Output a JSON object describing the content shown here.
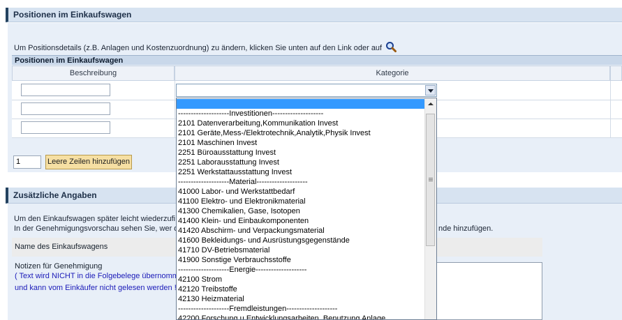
{
  "section1": {
    "title": "Positionen im Einkaufswagen",
    "info": "Um Positionsdetails (z.B. Anlagen und Kostenzuordnung) zu ändern, klicken Sie unten auf den Link oder auf"
  },
  "table": {
    "title": "Positionen im Einkaufswagen",
    "col_description": "Beschreibung",
    "col_category": "Kategorie"
  },
  "add_rows": {
    "quantity": "1",
    "button_label": "Leere Zeilen hinzufügen"
  },
  "section2": {
    "title": "Zusätzliche Angaben",
    "line1": "Um den Einkaufswagen später leicht wiederzufi",
    "line2": "In der Genehmigungsvorschau sehen Sie, wer d",
    "line2_end": "nde hinzufügen.",
    "cart_name_label": "Name des Einkaufswagens",
    "notes_label": "Notizen für Genehmigung",
    "note_blue_1": "( Text wird NICHT in die Folgebelege übernomme",
    "note_blue_2": "und kann vom Einkäufer nicht gelesen werden !"
  },
  "dropdown_options": [
    "",
    "--------------------Investitionen--------------------",
    "2101 Datenverarbeitung,Kommunikation Invest",
    "2101 Geräte,Mess-/Elektrotechnik,Analytik,Physik Invest",
    "2101 Maschinen Invest",
    "2251 Büroausstattung Invest",
    "2251 Laborausstattung Invest",
    "2251 Werkstattausstattung Invest",
    "--------------------Material--------------------",
    "41000 Labor- und Werkstattbedarf",
    "41100 Elektro- und Elektronikmaterial",
    "41300 Chemikalien, Gase, Isotopen",
    "41400 Klein- und Einbaukomponenten",
    "41420 Abschirm- und Verpackungsmaterial",
    "41600 Bekleidungs- und Ausrüstungsgegenstände",
    "41710 DV-Betriebsmaterial",
    "41900 Sonstige Verbrauchsstoffe",
    "--------------------Energie--------------------",
    "42100 Strom",
    "42120 Treibstoffe",
    "42130 Heizmaterial",
    "--------------------Fremdleistungen--------------------",
    "42200 Forschung u Entwicklungsarbeiten, Benutzung Anlage"
  ],
  "colors": {
    "header_bg": "#d7e3f1",
    "panel_bg": "#e8eff8",
    "selected_option": "#3399ff",
    "button_bg": "#f6dfa3",
    "note_blue": "#1a1ab8"
  },
  "icons": [
    "magnifier-icon",
    "dropdown-arrow-icon",
    "scroll-up-icon"
  ]
}
